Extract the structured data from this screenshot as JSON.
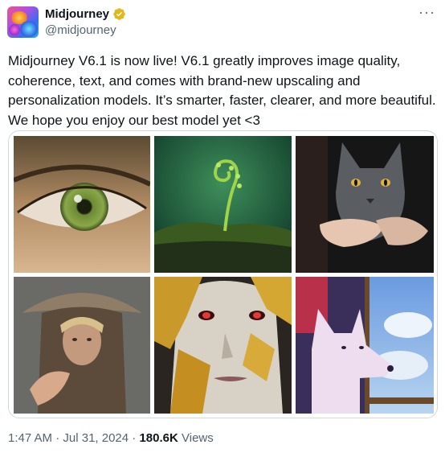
{
  "author": {
    "display_name": "Midjourney",
    "handle": "@midjourney",
    "avatar_icon": "midjourney-avatar",
    "verified_icon": "verified-gold-badge-icon"
  },
  "more_icon": "more-options-icon",
  "tweet": {
    "text": "Midjourney V6.1 is now live! V6.1 greatly improves image quality, coherence, text, and comes with brand-new upscaling and personalization models. It’s smarter, faster, clearer, and more beautiful. We hope you enjoy our best model yet <3"
  },
  "media": {
    "images": [
      "green-eye-image",
      "fern-sprout-image",
      "grey-cat-image",
      "hooded-figure-image",
      "gold-leaf-face-image",
      "white-wolf-image"
    ]
  },
  "meta": {
    "time": "1:47 AM",
    "sep1": " · ",
    "date": "Jul 31, 2024",
    "sep2": " · ",
    "views_count": "180.6K",
    "views_label": " Views"
  },
  "colors": {
    "text": "#0f1419",
    "secondary": "#536471",
    "border": "#cfd9de",
    "verified_gold": "#e2b719"
  }
}
